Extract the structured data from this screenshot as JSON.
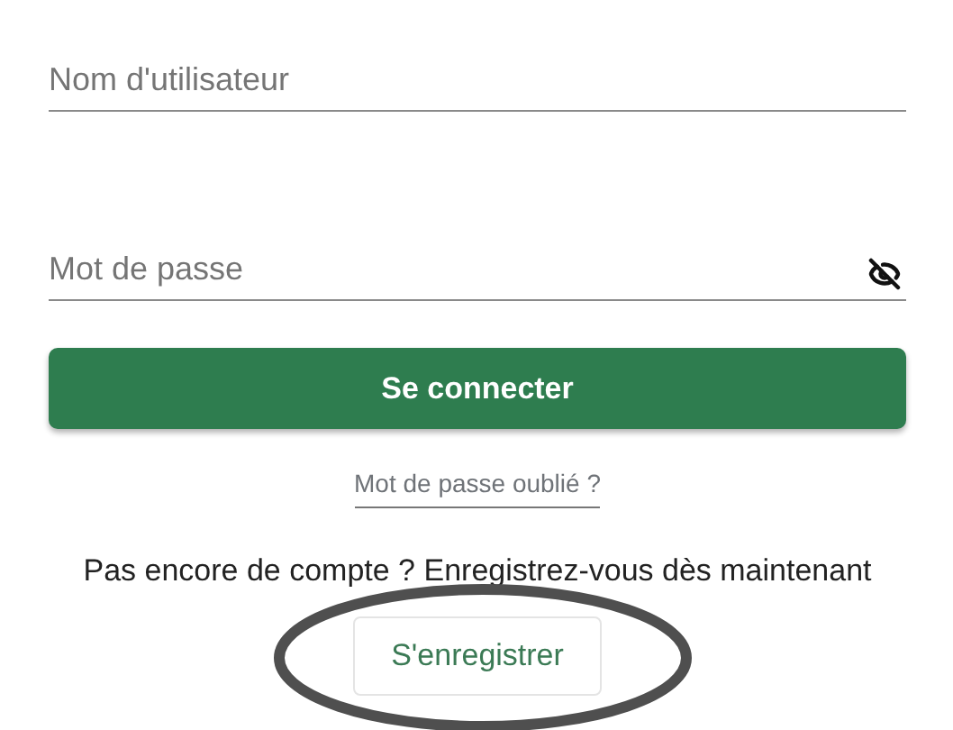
{
  "username": {
    "placeholder": "Nom d'utilisateur"
  },
  "password": {
    "placeholder": "Mot de passe",
    "visible": false
  },
  "login_button": "Se connecter",
  "forgot_link": "Mot de passe oublié ?",
  "signup_prompt": "Pas encore de compte ? Enregistrez-vous dès maintenant",
  "register_button": {
    "label": "S'enregistrer",
    "highlighted": true
  }
}
